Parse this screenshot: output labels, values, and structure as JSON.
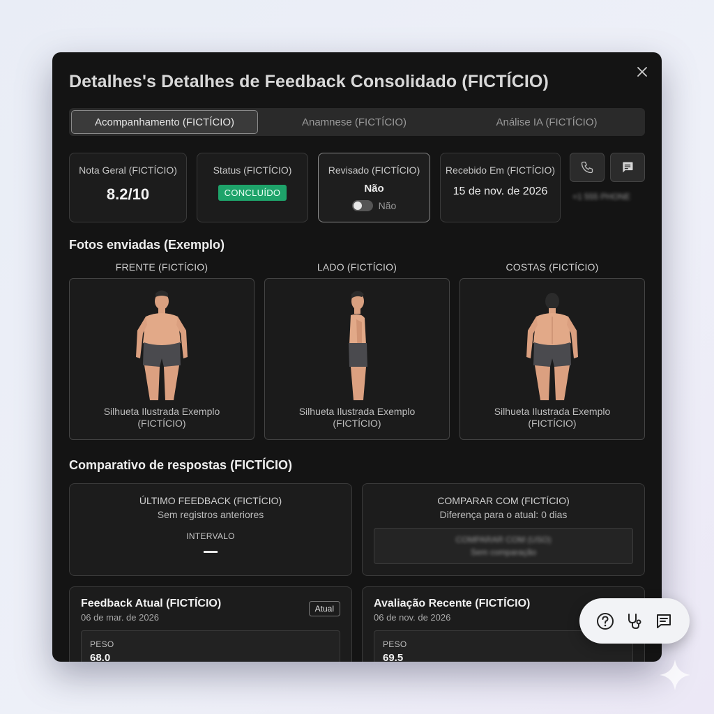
{
  "modal": {
    "title": "Detalhes's Detalhes de Feedback Consolidado (FICTÍCIO)"
  },
  "tabs": [
    {
      "label": "Acompanhamento (FICTÍCIO)",
      "active": true
    },
    {
      "label": "Anamnese (FICTÍCIO)",
      "active": false
    },
    {
      "label": "Análise IA (FICTÍCIO)",
      "active": false
    }
  ],
  "stats": {
    "nota": {
      "label": "Nota Geral (FICTÍCIO)",
      "value": "8.2/10"
    },
    "status": {
      "label": "Status (FICTÍCIO)",
      "value": "CONCLUÍDO",
      "color": "#1ea36a"
    },
    "revisado": {
      "label": "Revisado (FICTÍCIO)",
      "value": "Não",
      "toggle_label": "Não"
    },
    "recebido": {
      "label": "Recebido Em (FICTÍCIO)",
      "value": "15 de nov. de 2026"
    }
  },
  "contact": {
    "phone_icon": "phone-icon",
    "message_icon": "message-icon",
    "phone_number": "+1 555 PHONE"
  },
  "photos": {
    "section_title": "Fotos enviadas (Exemplo)",
    "items": [
      {
        "label": "FRENTE (FICTÍCIO)",
        "caption1": "Silhueta Ilustrada Exemplo",
        "caption2": "(FICTÍCIO)"
      },
      {
        "label": "LADO (FICTÍCIO)",
        "caption1": "Silhueta Ilustrada Exemplo",
        "caption2": "(FICTÍCIO)"
      },
      {
        "label": "COSTAS (FICTÍCIO)",
        "caption1": "Silhueta Ilustrada Exemplo",
        "caption2": "(FICTÍCIO)"
      }
    ]
  },
  "comparison": {
    "section_title": "Comparativo de respostas (FICTÍCIO)",
    "last": {
      "title": "ÚLTIMO FEEDBACK (FICTÍCIO)",
      "subtitle": "Sem registros anteriores",
      "interval_label": "INTERVALO"
    },
    "compare": {
      "title": "COMPARAR COM (FICTÍCIO)",
      "subtitle": "Diferença para o atual: 0 dias",
      "select_label": "COMPARAR COM (USO)",
      "select_value": "Sem comparação"
    }
  },
  "feedbacks": [
    {
      "title": "Feedback Atual (FICTÍCIO)",
      "date": "06 de mar. de 2026",
      "tag": "Atual",
      "metric_label": "PESO",
      "metric_value": "68.0"
    },
    {
      "title": "Avaliação Recente (FICTÍCIO)",
      "date": "06 de nov. de 2026",
      "metric_label": "PESO",
      "metric_value": "69.5"
    }
  ],
  "fab": {
    "icons": [
      "help-icon",
      "stethoscope-icon",
      "chat-icon"
    ]
  }
}
